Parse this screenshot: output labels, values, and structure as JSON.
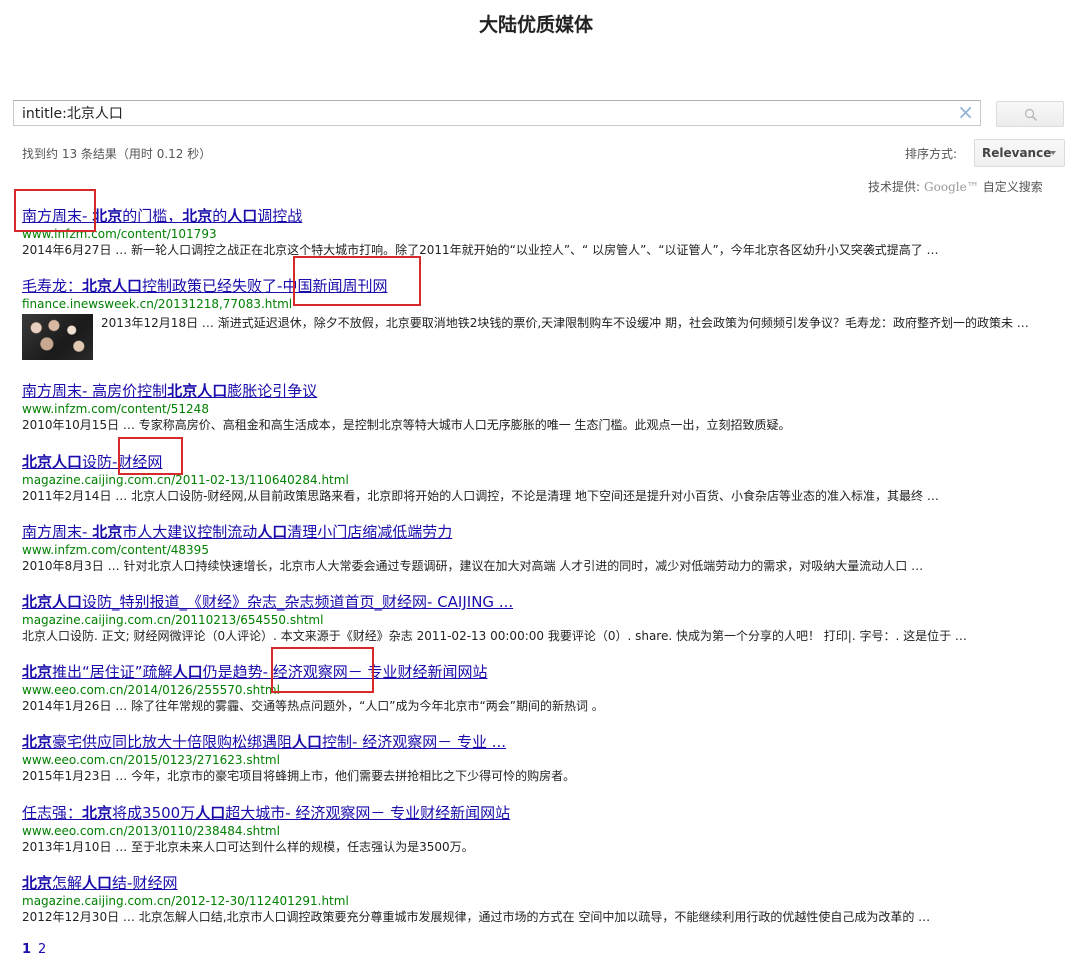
{
  "page": {
    "title": "大陆优质媒体"
  },
  "search": {
    "query": "intitle:北京人口",
    "clear_icon": "×",
    "button_icon": "search-icon"
  },
  "stats": {
    "result_count": "找到约 13 条结果（用时 0.12 秒）"
  },
  "sort": {
    "label": "排序方式:",
    "value": "Relevance"
  },
  "powered_by": {
    "prefix": "技术提供:",
    "google": "Google™",
    "suffix": "自定义搜索"
  },
  "results": [
    {
      "title_parts": [
        [
          "南方周末- ",
          false
        ],
        [
          "北京",
          true
        ],
        [
          "的门槛，",
          false
        ],
        [
          "北京",
          true
        ],
        [
          "的",
          false
        ],
        [
          "人口",
          true
        ],
        [
          "调控战",
          false
        ]
      ],
      "url": "www.infzm.com/content/101793",
      "snippet": "2014年6月27日 … 新一轮人口调控之战正在北京这个特大城市打响。除了2011年就开始的“以业控人”、“ 以房管人”、“以证管人”，今年北京各区幼升小又突袭式提高了 …"
    },
    {
      "title_parts": [
        [
          "毛寿龙：",
          false
        ],
        [
          "北京人口",
          true
        ],
        [
          "控制政策已经失败了-中国新闻周刊网",
          false
        ]
      ],
      "url": "finance.inewsweek.cn/20131218,77083.html",
      "snippet": "2013年12月18日 … 渐进式延迟退休，除夕不放假，北京要取消地铁2块钱的票价,天津限制购车不设缓冲 期，社会政策为何频频引发争议？毛寿龙：政府整齐划一的政策未 …",
      "has_thumb": true
    },
    {
      "title_parts": [
        [
          "南方周末- 高房价控制",
          false
        ],
        [
          "北京人口",
          true
        ],
        [
          "膨胀论引争议",
          false
        ]
      ],
      "url": "www.infzm.com/content/51248",
      "snippet": "2010年10月15日 … 专家称高房价、高租金和高生活成本，是控制北京等特大城市人口无序膨胀的唯一 生态门槛。此观点一出，立刻招致质疑。"
    },
    {
      "title_parts": [
        [
          "北京人口",
          true
        ],
        [
          "设防-财经网",
          false
        ]
      ],
      "url": "magazine.caijing.com.cn/2011-02-13/110640284.html",
      "snippet": "2011年2月14日 … 北京人口设防-财经网,从目前政策思路来看，北京即将开始的人口调控，不论是清理 地下空间还是提升对小百货、小食杂店等业态的准入标准，其最终 …"
    },
    {
      "title_parts": [
        [
          "南方周末- ",
          false
        ],
        [
          "北京",
          true
        ],
        [
          "市人大建议控制流动",
          false
        ],
        [
          "人口",
          true
        ],
        [
          "清理小门店缩减低端劳力",
          false
        ]
      ],
      "url": "www.infzm.com/content/48395",
      "snippet": "2010年8月3日 … 针对北京人口持续快速增长，北京市人大常委会通过专题调研，建议在加大对高端 人才引进的同时，减少对低端劳动力的需求，对吸纳大量流动人口 …"
    },
    {
      "title_parts": [
        [
          "北京人口",
          true
        ],
        [
          "设防_特别报道_《财经》杂志_杂志频道首页_财经网- CAIJING ...",
          false
        ]
      ],
      "url": "magazine.caijing.com.cn/20110213/654550.shtml",
      "snippet": "北京人口设防. 正文; 财经网微评论（0人评论）. 本文来源于《财经》杂志 2011-02-13 00:00:00 我要评论（0）. share. 快成为第一个分享的人吧！ 打印|. 字号：. 这是位于 …"
    },
    {
      "title_parts": [
        [
          "北京",
          true
        ],
        [
          "推出“居住证”疏解",
          false
        ],
        [
          "人口",
          true
        ],
        [
          "仍是趋势- 经济观察网－ 专业财经新闻网站",
          false
        ]
      ],
      "url": "www.eeo.com.cn/2014/0126/255570.shtml",
      "snippet": "2014年1月26日 … 除了往年常规的雾霾、交通等热点问题外，“人口”成为今年北京市“两会”期间的新热词 。"
    },
    {
      "title_parts": [
        [
          "北京",
          true
        ],
        [
          "豪宅供应同比放大十倍限购松绑遇阻",
          false
        ],
        [
          "人口",
          true
        ],
        [
          "控制- 经济观察网－ 专业 ...",
          false
        ]
      ],
      "url": "www.eeo.com.cn/2015/0123/271623.shtml",
      "snippet": "2015年1月23日 … 今年，北京市的豪宅项目将蜂拥上市，他们需要去拼抢相比之下少得可怜的购房者。"
    },
    {
      "title_parts": [
        [
          "任志强：",
          false
        ],
        [
          "北京",
          true
        ],
        [
          "将成3500万",
          false
        ],
        [
          "人口",
          true
        ],
        [
          "超大城市- 经济观察网－ 专业财经新闻网站",
          false
        ]
      ],
      "url": "www.eeo.com.cn/2013/0110/238484.shtml",
      "snippet": "2013年1月10日 … 至于北京未来人口可达到什么样的规模，任志强认为是3500万。"
    },
    {
      "title_parts": [
        [
          "北京",
          true
        ],
        [
          "怎解",
          false
        ],
        [
          "人口",
          true
        ],
        [
          "结-财经网",
          false
        ]
      ],
      "url": "magazine.caijing.com.cn/2012-12-30/112401291.html",
      "snippet": "2012年12月30日 … 北京怎解人口结,北京市人口调控政策要充分尊重城市发展规律，通过市场的方式在 空间中加以疏导，不能继续利用行政的优越性使自己成为改革的 …"
    }
  ],
  "pagination": {
    "current": "1",
    "pages": [
      "2"
    ]
  },
  "colors": {
    "link": "#1a0dab",
    "url": "#008000",
    "highlight_box": "#d62a2a"
  }
}
